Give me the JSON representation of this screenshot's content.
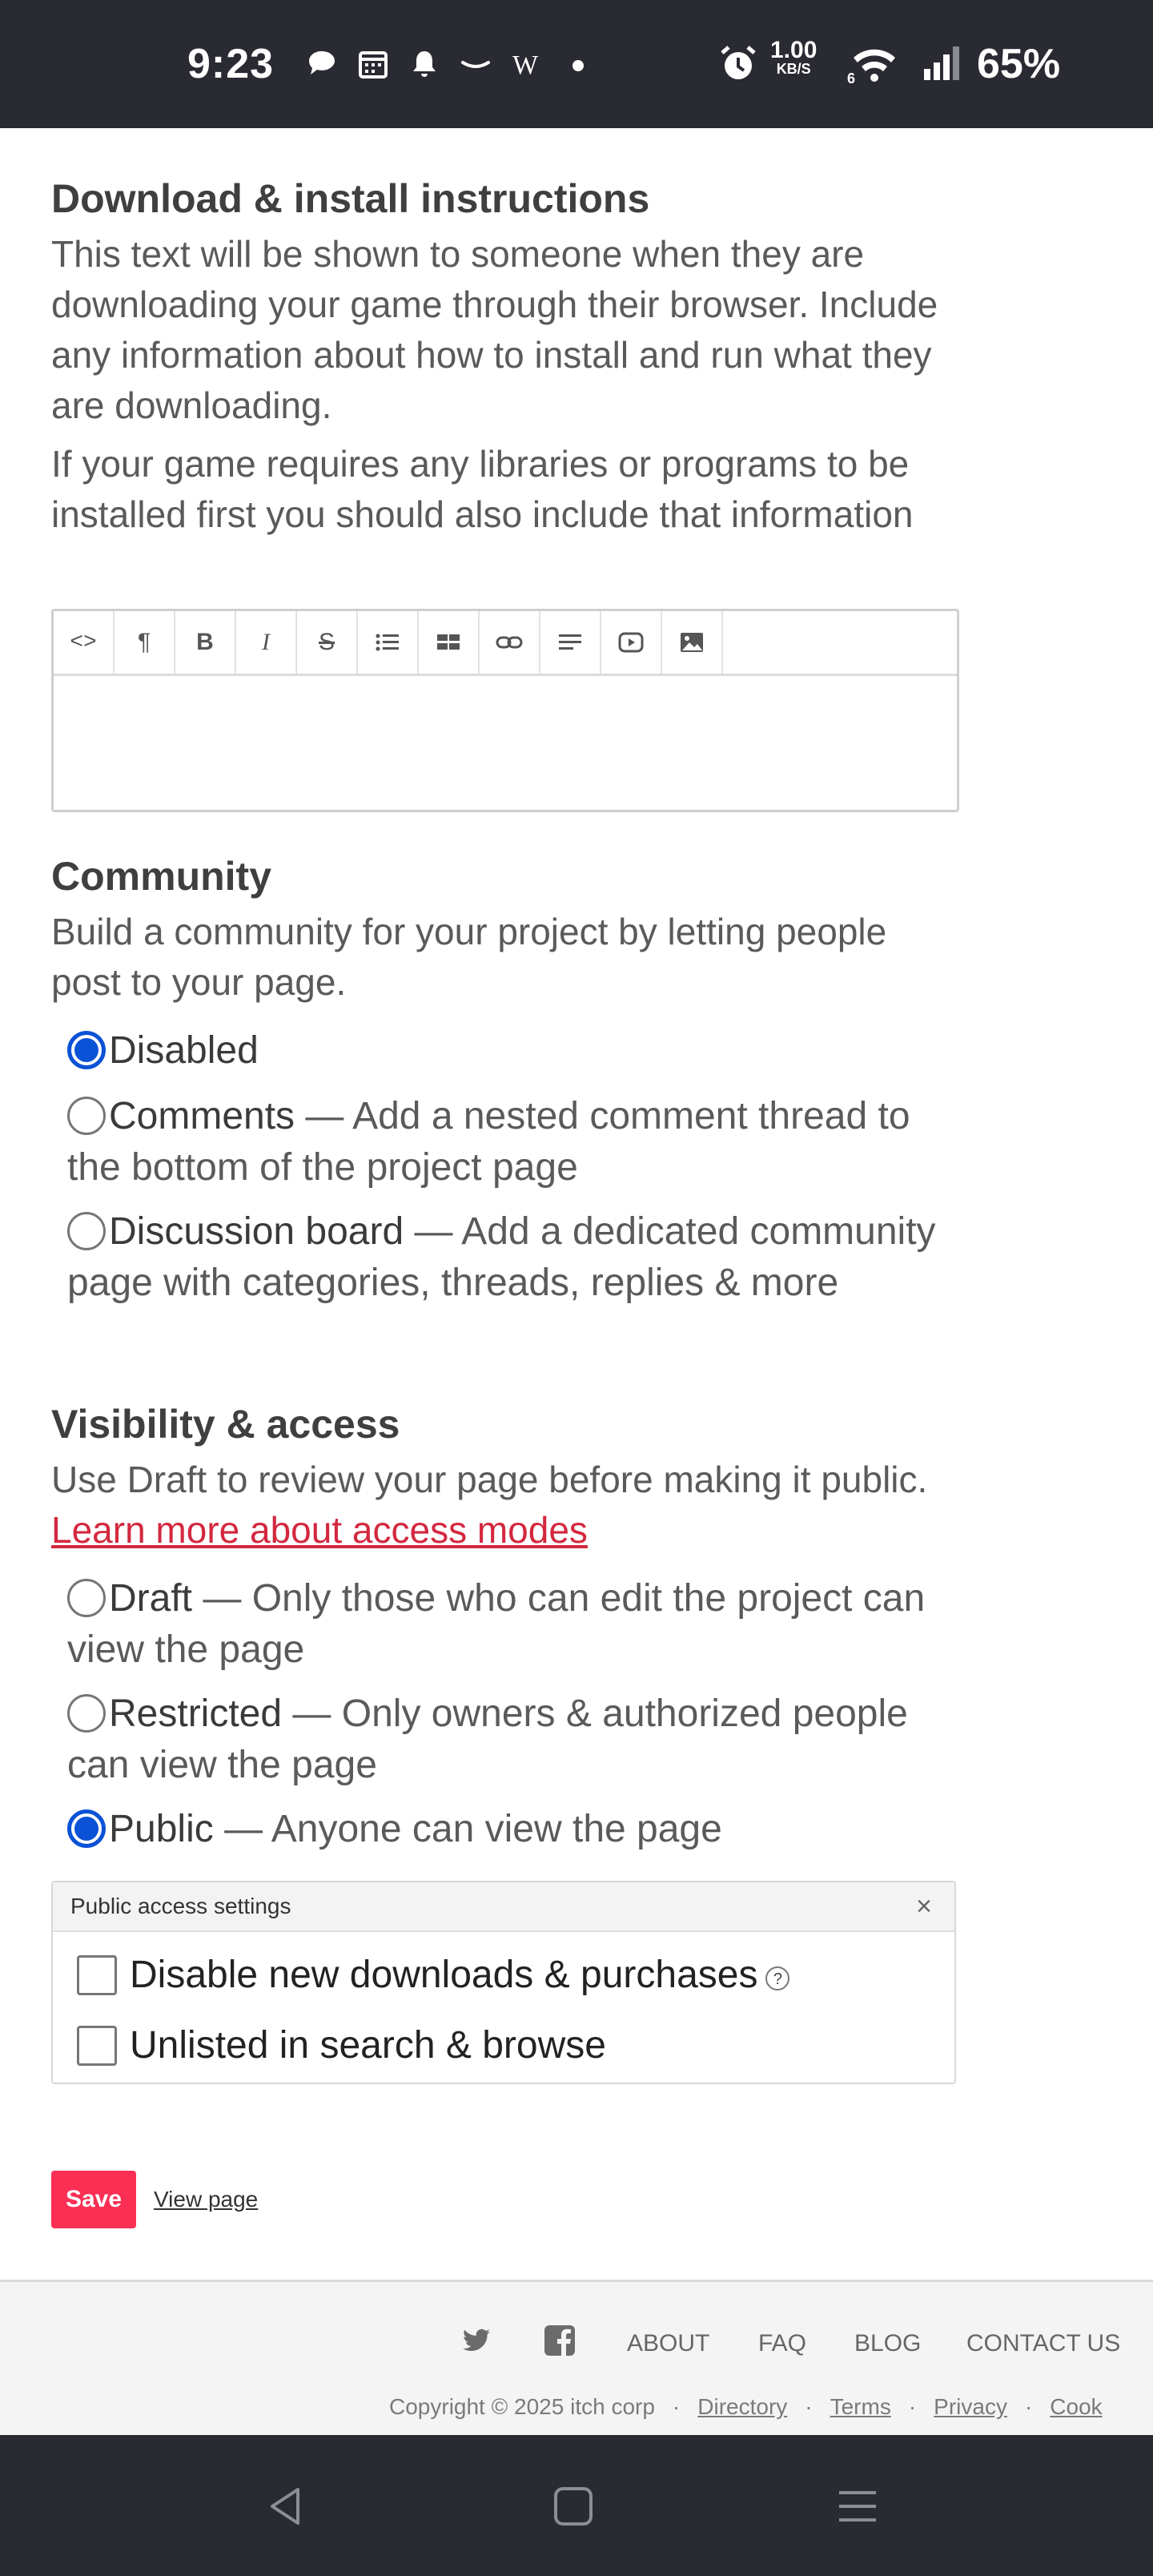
{
  "status_bar": {
    "time": "9:23",
    "speed_value": "1.00",
    "speed_unit": "KB/S",
    "battery": "65%",
    "icons": [
      "chat-icon",
      "calendar-icon",
      "bell-icon",
      "amazon-icon",
      "w-icon",
      "dot-icon",
      "alarm-icon",
      "wifi-icon",
      "signal-icon"
    ]
  },
  "install": {
    "title": "Download & install instructions",
    "desc1": "This text will be shown to someone when they are downloading your game through their browser. Include any information about how to install and run what they are downloading.",
    "desc2": "If your game requires any libraries or programs to be installed first you should also include that information",
    "toolbar": [
      "code-icon",
      "paragraph-icon",
      "bold-icon",
      "italic-icon",
      "strikethrough-icon",
      "bullet-list-icon",
      "table-icon",
      "link-icon",
      "align-icon",
      "video-icon",
      "image-icon"
    ],
    "toolbar_glyphs": {
      "code": "<>",
      "paragraph": "¶",
      "bold": "B",
      "italic": "I",
      "strike": "S"
    }
  },
  "community": {
    "title": "Community",
    "desc": "Build a community for your project by letting people post to your page.",
    "options": [
      {
        "label": "Disabled",
        "detail": "",
        "selected": true
      },
      {
        "label": "Comments",
        "detail": " — Add a nested comment thread to the bottom of the project page",
        "selected": false
      },
      {
        "label": "Discussion board",
        "detail": " — Add a dedicated community page with categories, threads, replies & more",
        "selected": false
      }
    ]
  },
  "visibility": {
    "title": "Visibility & access",
    "desc": "Use Draft to review your page before making it public.",
    "learn_more": "Learn more about access modes",
    "options": [
      {
        "label": "Draft",
        "detail": " — Only those who can edit the project can view the page",
        "selected": false
      },
      {
        "label": "Restricted",
        "detail": " — Only owners & authorized people can view the page",
        "selected": false
      },
      {
        "label": "Public",
        "detail": " — Anyone can view the page",
        "selected": true
      }
    ]
  },
  "public_settings": {
    "title": "Public access settings",
    "close": "×",
    "disable_downloads": "Disable new downloads & purchases",
    "help": "?",
    "unlisted": "Unlisted in search & browse"
  },
  "actions": {
    "save": "Save",
    "view_page": "View page"
  },
  "footer": {
    "links": [
      "ABOUT",
      "FAQ",
      "BLOG",
      "CONTACT US"
    ],
    "copyright": "Copyright © 2025 itch corp",
    "legal": [
      "Directory",
      "Terms",
      "Privacy",
      "Cook"
    ]
  },
  "colors": {
    "accent_red": "#fa2f53",
    "link_red": "#d3283f",
    "radio_blue": "#0a52d6",
    "bar_dark": "#2a2a33"
  }
}
